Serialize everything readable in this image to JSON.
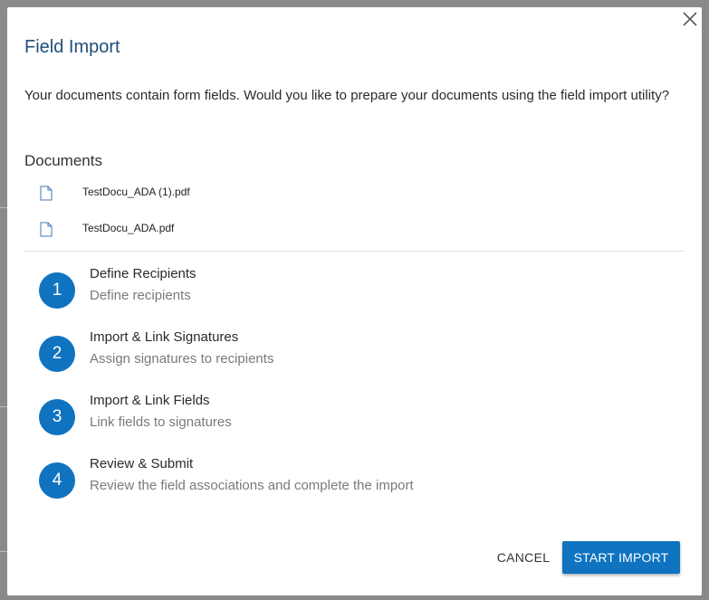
{
  "modal": {
    "title": "Field Import",
    "intro": "Your documents contain form fields. Would you like to prepare your documents using the field import utility?"
  },
  "documents": {
    "heading": "Documents",
    "files": [
      {
        "name": "TestDocu_ADA (1).pdf",
        "icon": "file-icon"
      },
      {
        "name": "TestDocu_ADA.pdf",
        "icon": "file-icon"
      }
    ]
  },
  "steps": [
    {
      "number": "1",
      "title": "Define Recipients",
      "description": "Define recipients"
    },
    {
      "number": "2",
      "title": "Import & Link Signatures",
      "description": "Assign signatures to recipients"
    },
    {
      "number": "3",
      "title": "Import & Link Fields",
      "description": "Link fields to signatures"
    },
    {
      "number": "4",
      "title": "Review & Submit",
      "description": "Review the field associations and complete the import"
    }
  ],
  "actions": {
    "cancel_label": "CANCEL",
    "start_label": "START IMPORT"
  },
  "colors": {
    "accent": "#0f73c0",
    "title": "#1f4e79",
    "overlay": "#8a8a8a"
  }
}
